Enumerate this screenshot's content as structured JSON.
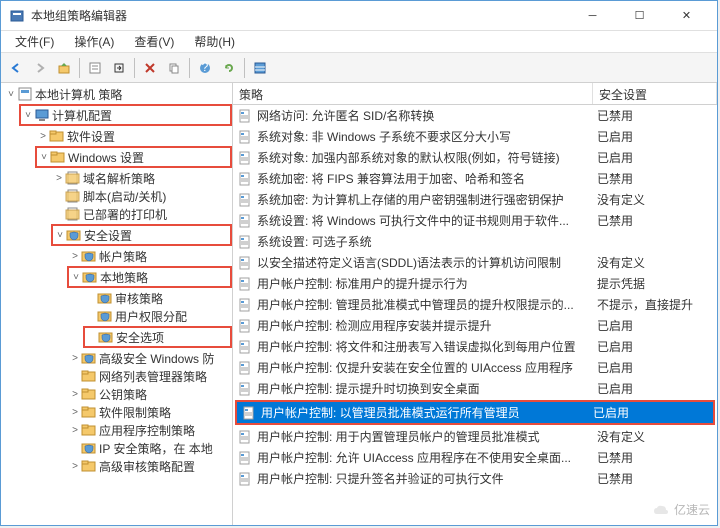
{
  "window": {
    "title": "本地组策略编辑器"
  },
  "menu": {
    "file": "文件(F)",
    "action": "操作(A)",
    "view": "查看(V)",
    "help": "帮助(H)"
  },
  "tree": {
    "root": "本地计算机 策略",
    "comp": "计算机配置",
    "soft": "软件设置",
    "win": "Windows 设置",
    "dns": "域名解析策略",
    "script": "脚本(启动/关机)",
    "printer": "已部署的打印机",
    "sec": "安全设置",
    "acct": "帐户策略",
    "local": "本地策略",
    "audit": "审核策略",
    "rights": "用户权限分配",
    "secopt": "安全选项",
    "winadv": "高级安全 Windows 防",
    "netlist": "网络列表管理器策略",
    "pubkey": "公钥策略",
    "softrest": "软件限制策略",
    "appctrl": "应用程序控制策略",
    "ipsec": "IP 安全策略，在 本地",
    "advaudit": "高级审核策略配置"
  },
  "cols": {
    "policy": "策略",
    "setting": "安全设置"
  },
  "rows": [
    {
      "p": "网络访问: 允许匿名 SID/名称转换",
      "s": "已禁用"
    },
    {
      "p": "系统对象: 非 Windows 子系统不要求区分大小写",
      "s": "已启用"
    },
    {
      "p": "系统对象: 加强内部系统对象的默认权限(例如，符号链接)",
      "s": "已启用"
    },
    {
      "p": "系统加密: 将 FIPS 兼容算法用于加密、哈希和签名",
      "s": "已禁用"
    },
    {
      "p": "系统加密: 为计算机上存储的用户密钥强制进行强密钥保护",
      "s": "没有定义"
    },
    {
      "p": "系统设置: 将 Windows 可执行文件中的证书规则用于软件...",
      "s": "已禁用"
    },
    {
      "p": "系统设置: 可选子系统",
      "s": ""
    },
    {
      "p": "以安全描述符定义语言(SDDL)语法表示的计算机访问限制",
      "s": "没有定义"
    },
    {
      "p": "用户帐户控制: 标准用户的提升提示行为",
      "s": "提示凭据"
    },
    {
      "p": "用户帐户控制: 管理员批准模式中管理员的提升权限提示的...",
      "s": "不提示，直接提升"
    },
    {
      "p": "用户帐户控制: 检测应用程序安装并提示提升",
      "s": "已启用"
    },
    {
      "p": "用户帐户控制: 将文件和注册表写入错误虚拟化到每用户位置",
      "s": "已启用"
    },
    {
      "p": "用户帐户控制: 仅提升安装在安全位置的 UIAccess 应用程序",
      "s": "已启用"
    },
    {
      "p": "用户帐户控制: 提示提升时切换到安全桌面",
      "s": "已启用"
    },
    {
      "p": "用户帐户控制: 以管理员批准模式运行所有管理员",
      "s": "已启用",
      "sel": true,
      "hl": true
    },
    {
      "p": "用户帐户控制: 用于内置管理员帐户的管理员批准模式",
      "s": "没有定义"
    },
    {
      "p": "用户帐户控制: 允许 UIAccess 应用程序在不使用安全桌面...",
      "s": "已禁用"
    },
    {
      "p": "用户帐户控制: 只提升签名并验证的可执行文件",
      "s": "已禁用"
    }
  ],
  "watermark": "亿速云"
}
